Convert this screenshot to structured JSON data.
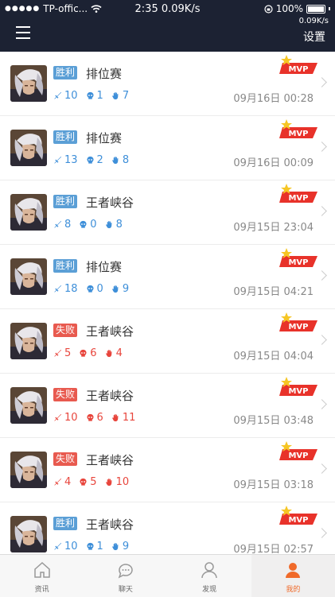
{
  "status_bar": {
    "carrier": "TP-offic...",
    "time": "2:35",
    "speed": "0.09K/s",
    "battery": "100%",
    "speed_small": "0.09K/s"
  },
  "header": {
    "settings_label": "设置"
  },
  "matches": [
    {
      "result": "胜利",
      "result_type": "win",
      "mode": "排位赛",
      "kills": "10",
      "deaths": "1",
      "assists": "7",
      "date": "09月16日 00:28"
    },
    {
      "result": "胜利",
      "result_type": "win",
      "mode": "排位赛",
      "kills": "13",
      "deaths": "2",
      "assists": "8",
      "date": "09月16日 00:09"
    },
    {
      "result": "胜利",
      "result_type": "win",
      "mode": "王者峡谷",
      "kills": "8",
      "deaths": "0",
      "assists": "8",
      "date": "09月15日 23:04"
    },
    {
      "result": "胜利",
      "result_type": "win",
      "mode": "排位赛",
      "kills": "18",
      "deaths": "0",
      "assists": "9",
      "date": "09月15日 04:21"
    },
    {
      "result": "失败",
      "result_type": "lose",
      "mode": "王者峡谷",
      "kills": "5",
      "deaths": "6",
      "assists": "4",
      "date": "09月15日 04:04"
    },
    {
      "result": "失败",
      "result_type": "lose",
      "mode": "王者峡谷",
      "kills": "10",
      "deaths": "6",
      "assists": "11",
      "date": "09月15日 03:48"
    },
    {
      "result": "失败",
      "result_type": "lose",
      "mode": "王者峡谷",
      "kills": "4",
      "deaths": "5",
      "assists": "10",
      "date": "09月15日 03:18"
    },
    {
      "result": "胜利",
      "result_type": "win",
      "mode": "王者峡谷",
      "kills": "10",
      "deaths": "1",
      "assists": "9",
      "date": "09月15日 02:57"
    }
  ],
  "mvp_label": "MVP",
  "tabs": [
    {
      "label": "资讯",
      "icon": "home-icon"
    },
    {
      "label": "聊天",
      "icon": "chat-icon"
    },
    {
      "label": "发现",
      "icon": "person-outline-icon"
    },
    {
      "label": "我的",
      "icon": "person-filled-icon"
    }
  ],
  "colors": {
    "header_bg": "#1c2233",
    "win": "#5b9fd6",
    "lose": "#e85a4f",
    "accent": "#f06a2a",
    "mvp": "#e8322a"
  }
}
